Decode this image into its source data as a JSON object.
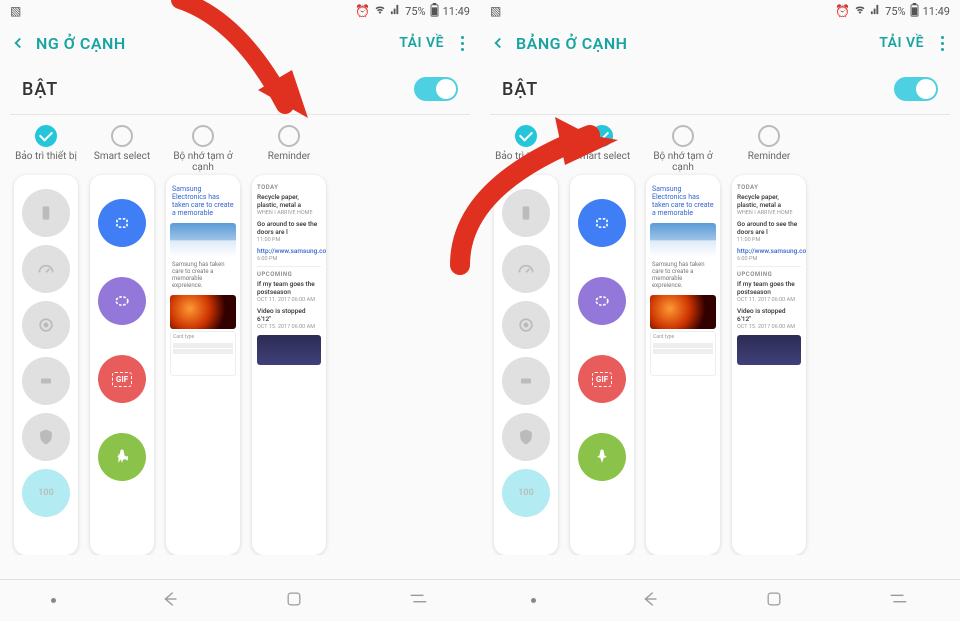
{
  "status": {
    "battery": "75%",
    "time": "11:49"
  },
  "header": {
    "title": "BẢNG Ở CẠNH",
    "title_partial": "NG Ở CẠNH",
    "download": "TẢI VỀ"
  },
  "toggle": {
    "label": "BẬT",
    "on": true
  },
  "panels": [
    {
      "id": "maintenance",
      "label": "Bảo trì thiết bị",
      "checked_left": true,
      "checked_right": true
    },
    {
      "id": "smartselect",
      "label": "Smart select",
      "checked_left": false,
      "checked_right": true
    },
    {
      "id": "clipboard",
      "label": "Bộ nhớ tạm ở cạnh",
      "checked_left": false,
      "checked_right": false
    },
    {
      "id": "reminder",
      "label": "Reminder",
      "checked_left": false,
      "checked_right": false
    }
  ],
  "maintenance": {
    "score": "100"
  },
  "clipboard": {
    "headline": "Samsung Electronics has taken care to create a memorable",
    "caption": "Samsung has taken care to create a memorable expreience.",
    "card_label": "Card type"
  },
  "reminder": {
    "sec1": "TODAY",
    "i1_title": "Recycle paper, plastic, metal a",
    "i1_sub": "WHEN I ARRIVE HOME",
    "i2_title": "Go around to see the doors are l",
    "i2_sub": "11:00 PM",
    "i3_title": "http://www.samsung.com",
    "i3_sub": "6:00 PM",
    "sec2": "UPCOMING",
    "i4_title": "If my team goes the postseason",
    "i4_sub": "OCT 11. 2017 06:00 AM",
    "i5_title": "Video is stopped 6'12\"",
    "i5_sub": "OCT 15. 2017 06:00 AM"
  }
}
